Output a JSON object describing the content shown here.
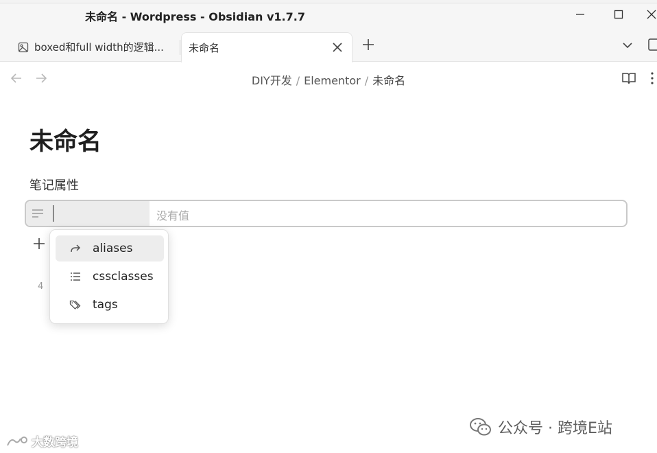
{
  "window": {
    "title": "未命名 - Wordpress - Obsidian v1.7.7",
    "minimize_icon": "minimize-icon",
    "maximize_icon": "maximize-icon",
    "close_icon": "close-icon"
  },
  "tabs": [
    {
      "label": "boxed和full width的逻辑...",
      "icon": "image-icon",
      "active": false
    },
    {
      "label": "未命名",
      "active": true,
      "close_icon": "x-icon"
    }
  ],
  "tabbar": {
    "new_tab_icon": "plus-icon",
    "tab_list_icon": "chevron-down-icon",
    "sidebar_icon": "sidebar-icon"
  },
  "header": {
    "breadcrumb": [
      {
        "label": "DIY开发"
      },
      {
        "label": "Elementor"
      },
      {
        "label": "未命名"
      }
    ],
    "separator": "/",
    "reading_icon": "book-open-icon",
    "more_icon": "more-vertical-icon"
  },
  "note": {
    "title": "未命名",
    "properties_heading": "笔记属性",
    "property": {
      "key_value": "",
      "value_placeholder": "没有值"
    },
    "line_count": "4"
  },
  "suggestions": [
    {
      "label": "aliases",
      "icon": "forward-arrow-icon",
      "selected": true
    },
    {
      "label": "cssclasses",
      "icon": "list-icon",
      "selected": false
    },
    {
      "label": "tags",
      "icon": "tags-icon",
      "selected": false
    }
  ],
  "watermark": {
    "right": "公众号 · 跨境E站",
    "left": "大数跨境"
  },
  "colors": {
    "accent_border": "#c9c9c9",
    "selected_item": "#ededed",
    "muted_text": "#aaaaaa"
  }
}
